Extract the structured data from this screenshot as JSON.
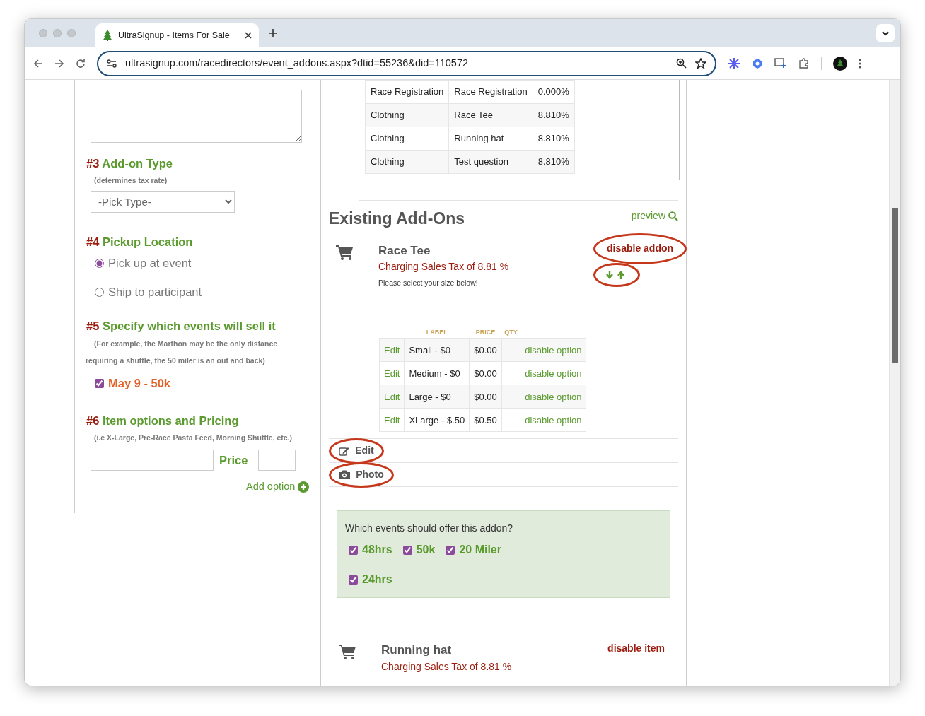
{
  "browser": {
    "tab_title": "UltraSignup - Items For Sale",
    "url": "ultrasignup.com/racedirectors/event_addons.aspx?dtid=55236&did=110572"
  },
  "form": {
    "sections": [
      {
        "kind": "select",
        "number": "#3",
        "title": "Add-on Type",
        "hint": "(determines tax rate)",
        "value": "-Pick Type-"
      },
      {
        "kind": "radio",
        "number": "#4",
        "title": "Pickup Location",
        "options": [
          {
            "label": "Pick up at event",
            "selected": true
          },
          {
            "label": "Ship to participant",
            "selected": false
          }
        ]
      },
      {
        "kind": "events",
        "number": "#5",
        "title": "Specify which events will sell it",
        "hint": "(For example, the Marthon may be the only distance requiring a shuttle, the 50 miler is an out and back)",
        "events": [
          {
            "label": "May 9 - 50k",
            "checked": true
          }
        ]
      },
      {
        "kind": "pricing",
        "number": "#6",
        "title": "Item options and Pricing",
        "hint": "(i.e X-Large, Pre-Race Pasta Feed, Morning Shuttle, etc.)",
        "price_label": "Price",
        "add_label": "Add option"
      }
    ]
  },
  "tax_table": {
    "rows": [
      [
        "Race Registration",
        "Race Registration",
        "0.000%"
      ],
      [
        "Clothing",
        "Race Tee",
        "8.810%"
      ],
      [
        "Clothing",
        "Running hat",
        "8.810%"
      ],
      [
        "Clothing",
        "Test question",
        "8.810%"
      ]
    ]
  },
  "existing": {
    "title": "Existing Add-Ons",
    "preview": "preview"
  },
  "addons": [
    {
      "name": "Race Tee",
      "tax_note": "Charging Sales Tax of 8.81 %",
      "description": "Please select your size below!",
      "action": "disable addon",
      "action_circled": true,
      "reorder_circled": true,
      "option_columns": [
        "LABEL",
        "PRICE",
        "QTY"
      ],
      "options": [
        {
          "edit": "Edit",
          "label": "Small - $0",
          "price": "$0.00",
          "action": "disable option"
        },
        {
          "edit": "Edit",
          "label": "Medium - $0",
          "price": "$0.00",
          "action": "disable option"
        },
        {
          "edit": "Edit",
          "label": "Large - $0",
          "price": "$0.00",
          "action": "disable option"
        },
        {
          "edit": "Edit",
          "label": "XLarge - $.50",
          "price": "$0.50",
          "action": "disable option"
        }
      ],
      "edit_button": {
        "label": "Edit",
        "circled": true
      },
      "photo_button": {
        "label": "Photo",
        "circled": true
      },
      "events_prompt": "Which events should offer this addon?",
      "events": [
        {
          "label": "48hrs",
          "checked": true
        },
        {
          "label": "50k",
          "checked": true
        },
        {
          "label": "20 Miler",
          "checked": true
        },
        {
          "label": "24hrs",
          "checked": true
        }
      ]
    },
    {
      "name": "Running hat",
      "tax_note": "Charging Sales Tax of 8.81 %",
      "action": "disable item",
      "action_circled": false
    }
  ]
}
